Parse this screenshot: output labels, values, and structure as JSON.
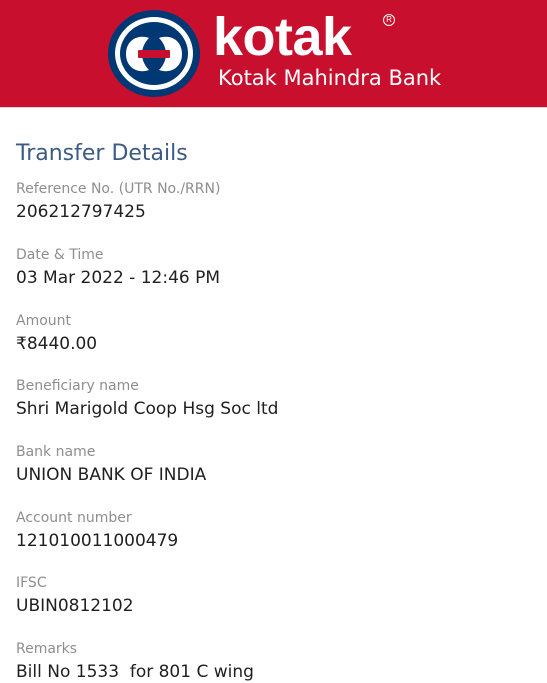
{
  "header": {
    "brand_name": "kotak",
    "registered_mark": "R",
    "bank_name": "Kotak Mahindra Bank",
    "colors": {
      "brand_red": "#c8102e",
      "logo_blue": "#003874",
      "white": "#ffffff"
    },
    "logo_icon": "kotak-logo-icon"
  },
  "main": {
    "title": "Transfer Details",
    "fields": [
      {
        "label": "Reference No. (UTR No./RRN)",
        "value": "206212797425"
      },
      {
        "label": "Date & Time",
        "value": "03 Mar 2022 - 12:46 PM"
      },
      {
        "label": "Amount",
        "value": "₹8440.00"
      },
      {
        "label": "Beneficiary name",
        "value": "Shri Marigold Coop Hsg Soc ltd"
      },
      {
        "label": "Bank name",
        "value": "UNION BANK OF INDIA"
      },
      {
        "label": "Account number",
        "value": "121010011000479"
      },
      {
        "label": "IFSC",
        "value": "UBIN0812102"
      },
      {
        "label": "Remarks",
        "value": "Bill No 1533  for 801 C wing"
      }
    ]
  }
}
